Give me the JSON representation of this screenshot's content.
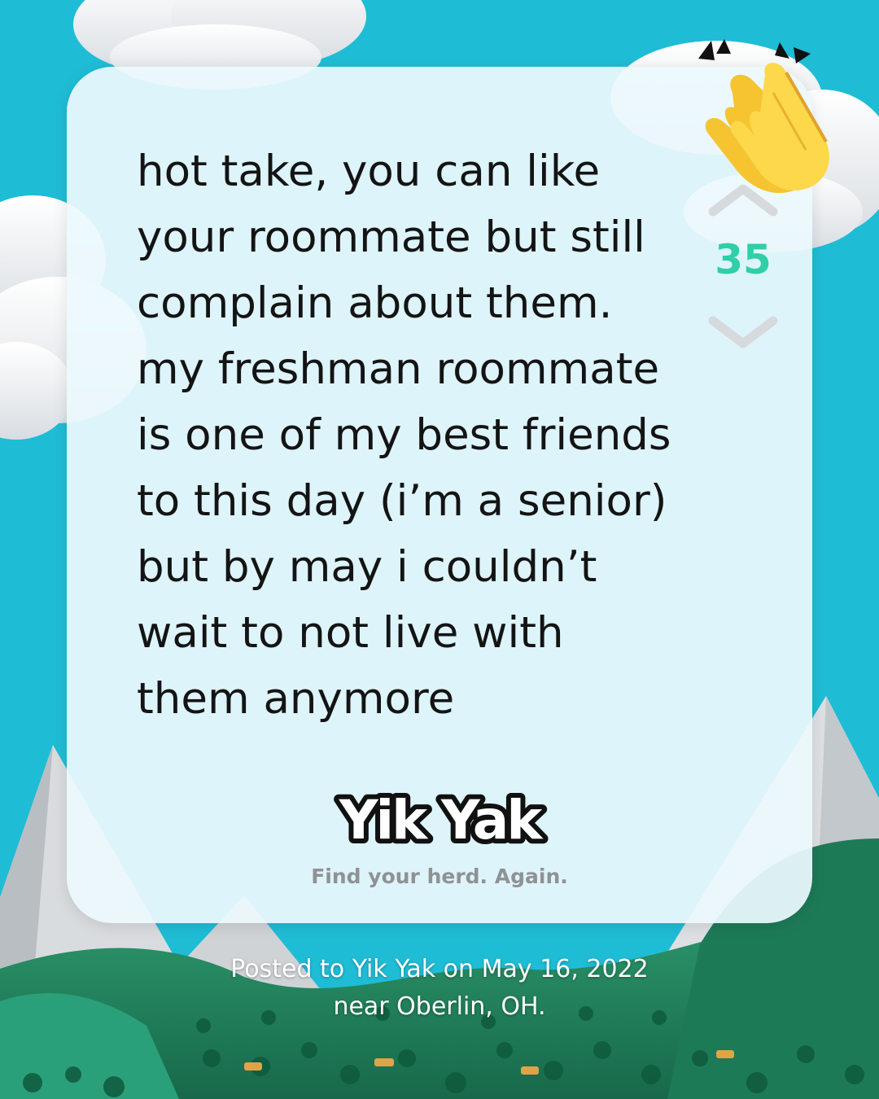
{
  "post": {
    "lines": [
      "hot take, you can like",
      "your roommate but still",
      "complain about them.",
      "my freshman roommate",
      "is one of my best friends",
      "to this day (i’m a senior)",
      "but by may i couldn’t",
      "wait to not live with",
      "them anymore"
    ]
  },
  "votes": {
    "count": "35",
    "up_icon": "chevron-up-icon",
    "down_icon": "chevron-down-icon"
  },
  "branding": {
    "logo_text": "Yik Yak",
    "tagline": "Find your herd. Again."
  },
  "footer": {
    "line1": "Posted to Yik Yak on May 16, 2022",
    "line2": "near Oberlin, OH."
  },
  "colors": {
    "sky": "#1fbcd6",
    "vote_count": "#2fcfa8",
    "card": "#ecf9fd",
    "tagline": "#8f9294"
  }
}
